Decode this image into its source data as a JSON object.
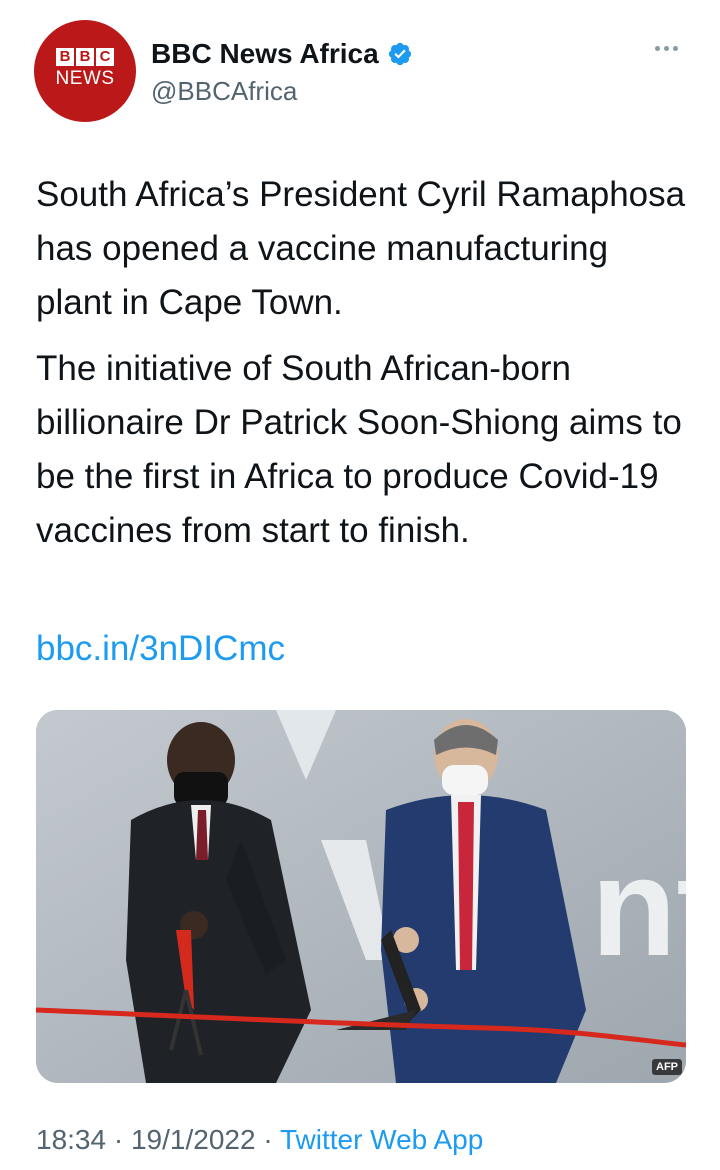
{
  "author": {
    "avatar_blocks": [
      "B",
      "B",
      "C"
    ],
    "avatar_word": "NEWS",
    "display_name": "BBC News Africa",
    "handle": "@BBCAfrica",
    "brand_color": "#bb1919",
    "verified_color": "#1d9bf0"
  },
  "tweet": {
    "paragraph_1": "South Africa’s President Cyril Ramaphosa has opened a vaccine manufacturing plant in Cape Town.",
    "paragraph_2": "The initiative of South African-born billionaire Dr Patrick Soon-Shiong aims to be the first in Africa to produce Covid-19 vaccines from start to finish.",
    "link": "bbc.in/3nDICmc"
  },
  "media": {
    "credit": "AFP",
    "wall_lettering": "nt"
  },
  "footer": {
    "time": "18:34",
    "separator": "·",
    "date": "19/1/2022",
    "source": "Twitter Web App",
    "link_color": "#1d9bf0"
  }
}
